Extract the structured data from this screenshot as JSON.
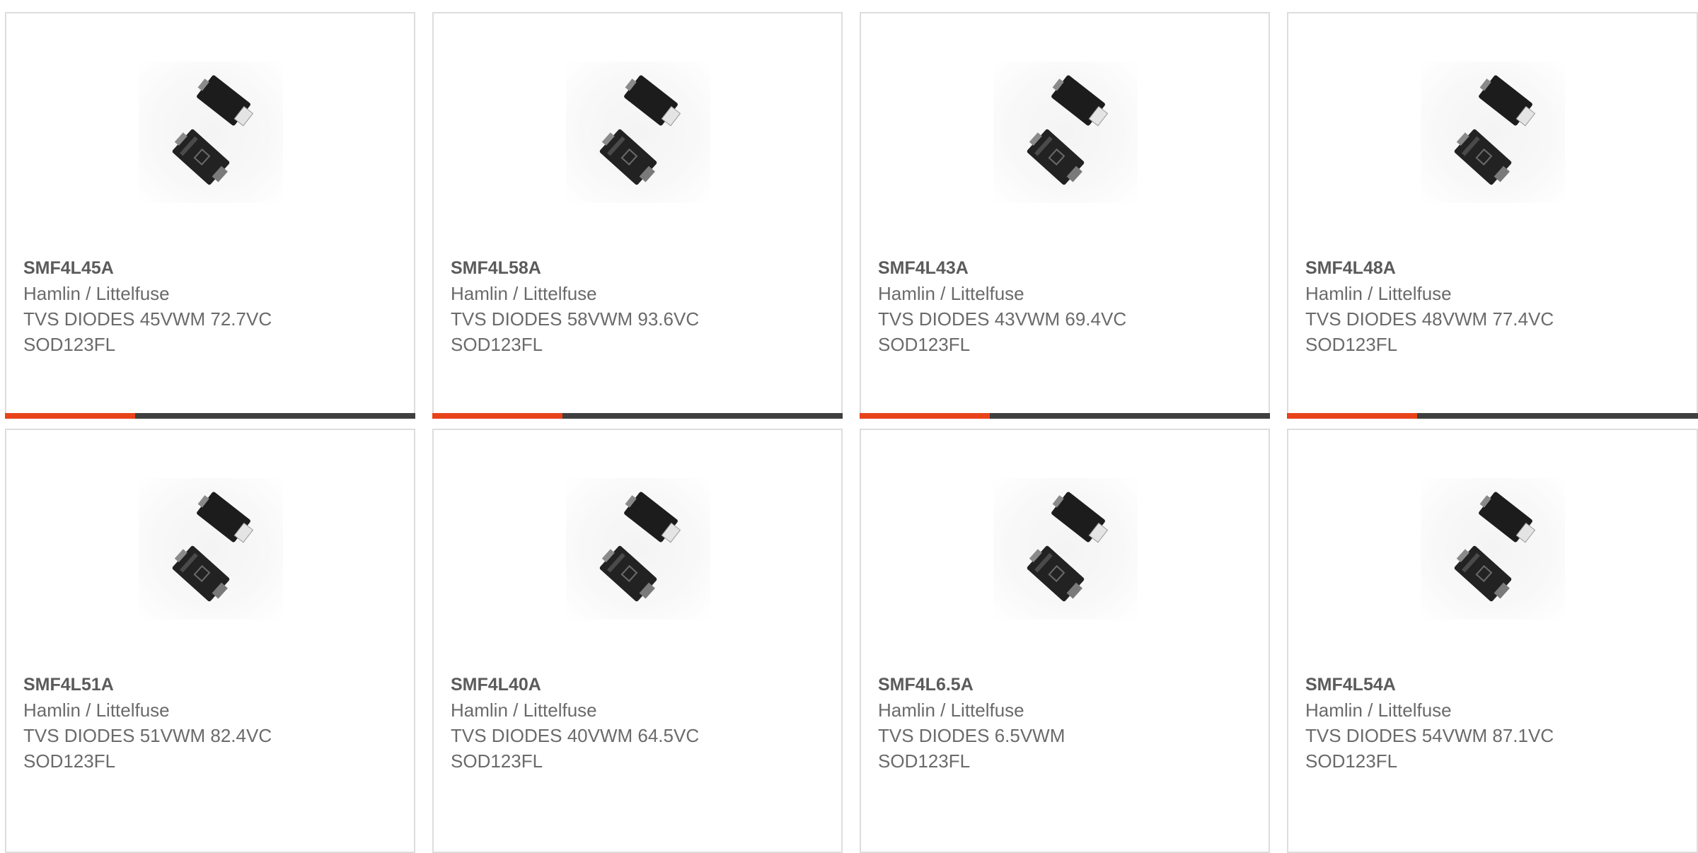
{
  "colors": {
    "accent": "#e8431a",
    "bar": "#3f3f3f",
    "border": "#dddddd",
    "text": "#666666"
  },
  "products": [
    {
      "part_number": "SMF4L45A",
      "manufacturer": "Hamlin / Littelfuse",
      "description": "TVS DIODES 45VWM 72.7VC\nSOD123FL",
      "icon": "diode-package-image"
    },
    {
      "part_number": "SMF4L58A",
      "manufacturer": "Hamlin / Littelfuse",
      "description": "TVS DIODES 58VWM 93.6VC\nSOD123FL",
      "icon": "diode-package-image"
    },
    {
      "part_number": "SMF4L43A",
      "manufacturer": "Hamlin / Littelfuse",
      "description": "TVS DIODES 43VWM 69.4VC\nSOD123FL",
      "icon": "diode-package-image"
    },
    {
      "part_number": "SMF4L48A",
      "manufacturer": "Hamlin / Littelfuse",
      "description": "TVS DIODES 48VWM 77.4VC\nSOD123FL",
      "icon": "diode-package-image"
    },
    {
      "part_number": "SMF4L51A",
      "manufacturer": "Hamlin / Littelfuse",
      "description": "TVS DIODES 51VWM 82.4VC\nSOD123FL",
      "icon": "diode-package-image"
    },
    {
      "part_number": "SMF4L40A",
      "manufacturer": "Hamlin / Littelfuse",
      "description": "TVS DIODES 40VWM 64.5VC\nSOD123FL",
      "icon": "diode-package-image"
    },
    {
      "part_number": "SMF4L6.5A",
      "manufacturer": "Hamlin / Littelfuse",
      "description": "TVS DIODES 6.5VWM\nSOD123FL",
      "icon": "diode-package-image"
    },
    {
      "part_number": "SMF4L54A",
      "manufacturer": "Hamlin / Littelfuse",
      "description": "TVS DIODES 54VWM 87.1VC\nSOD123FL",
      "icon": "diode-package-image"
    }
  ]
}
